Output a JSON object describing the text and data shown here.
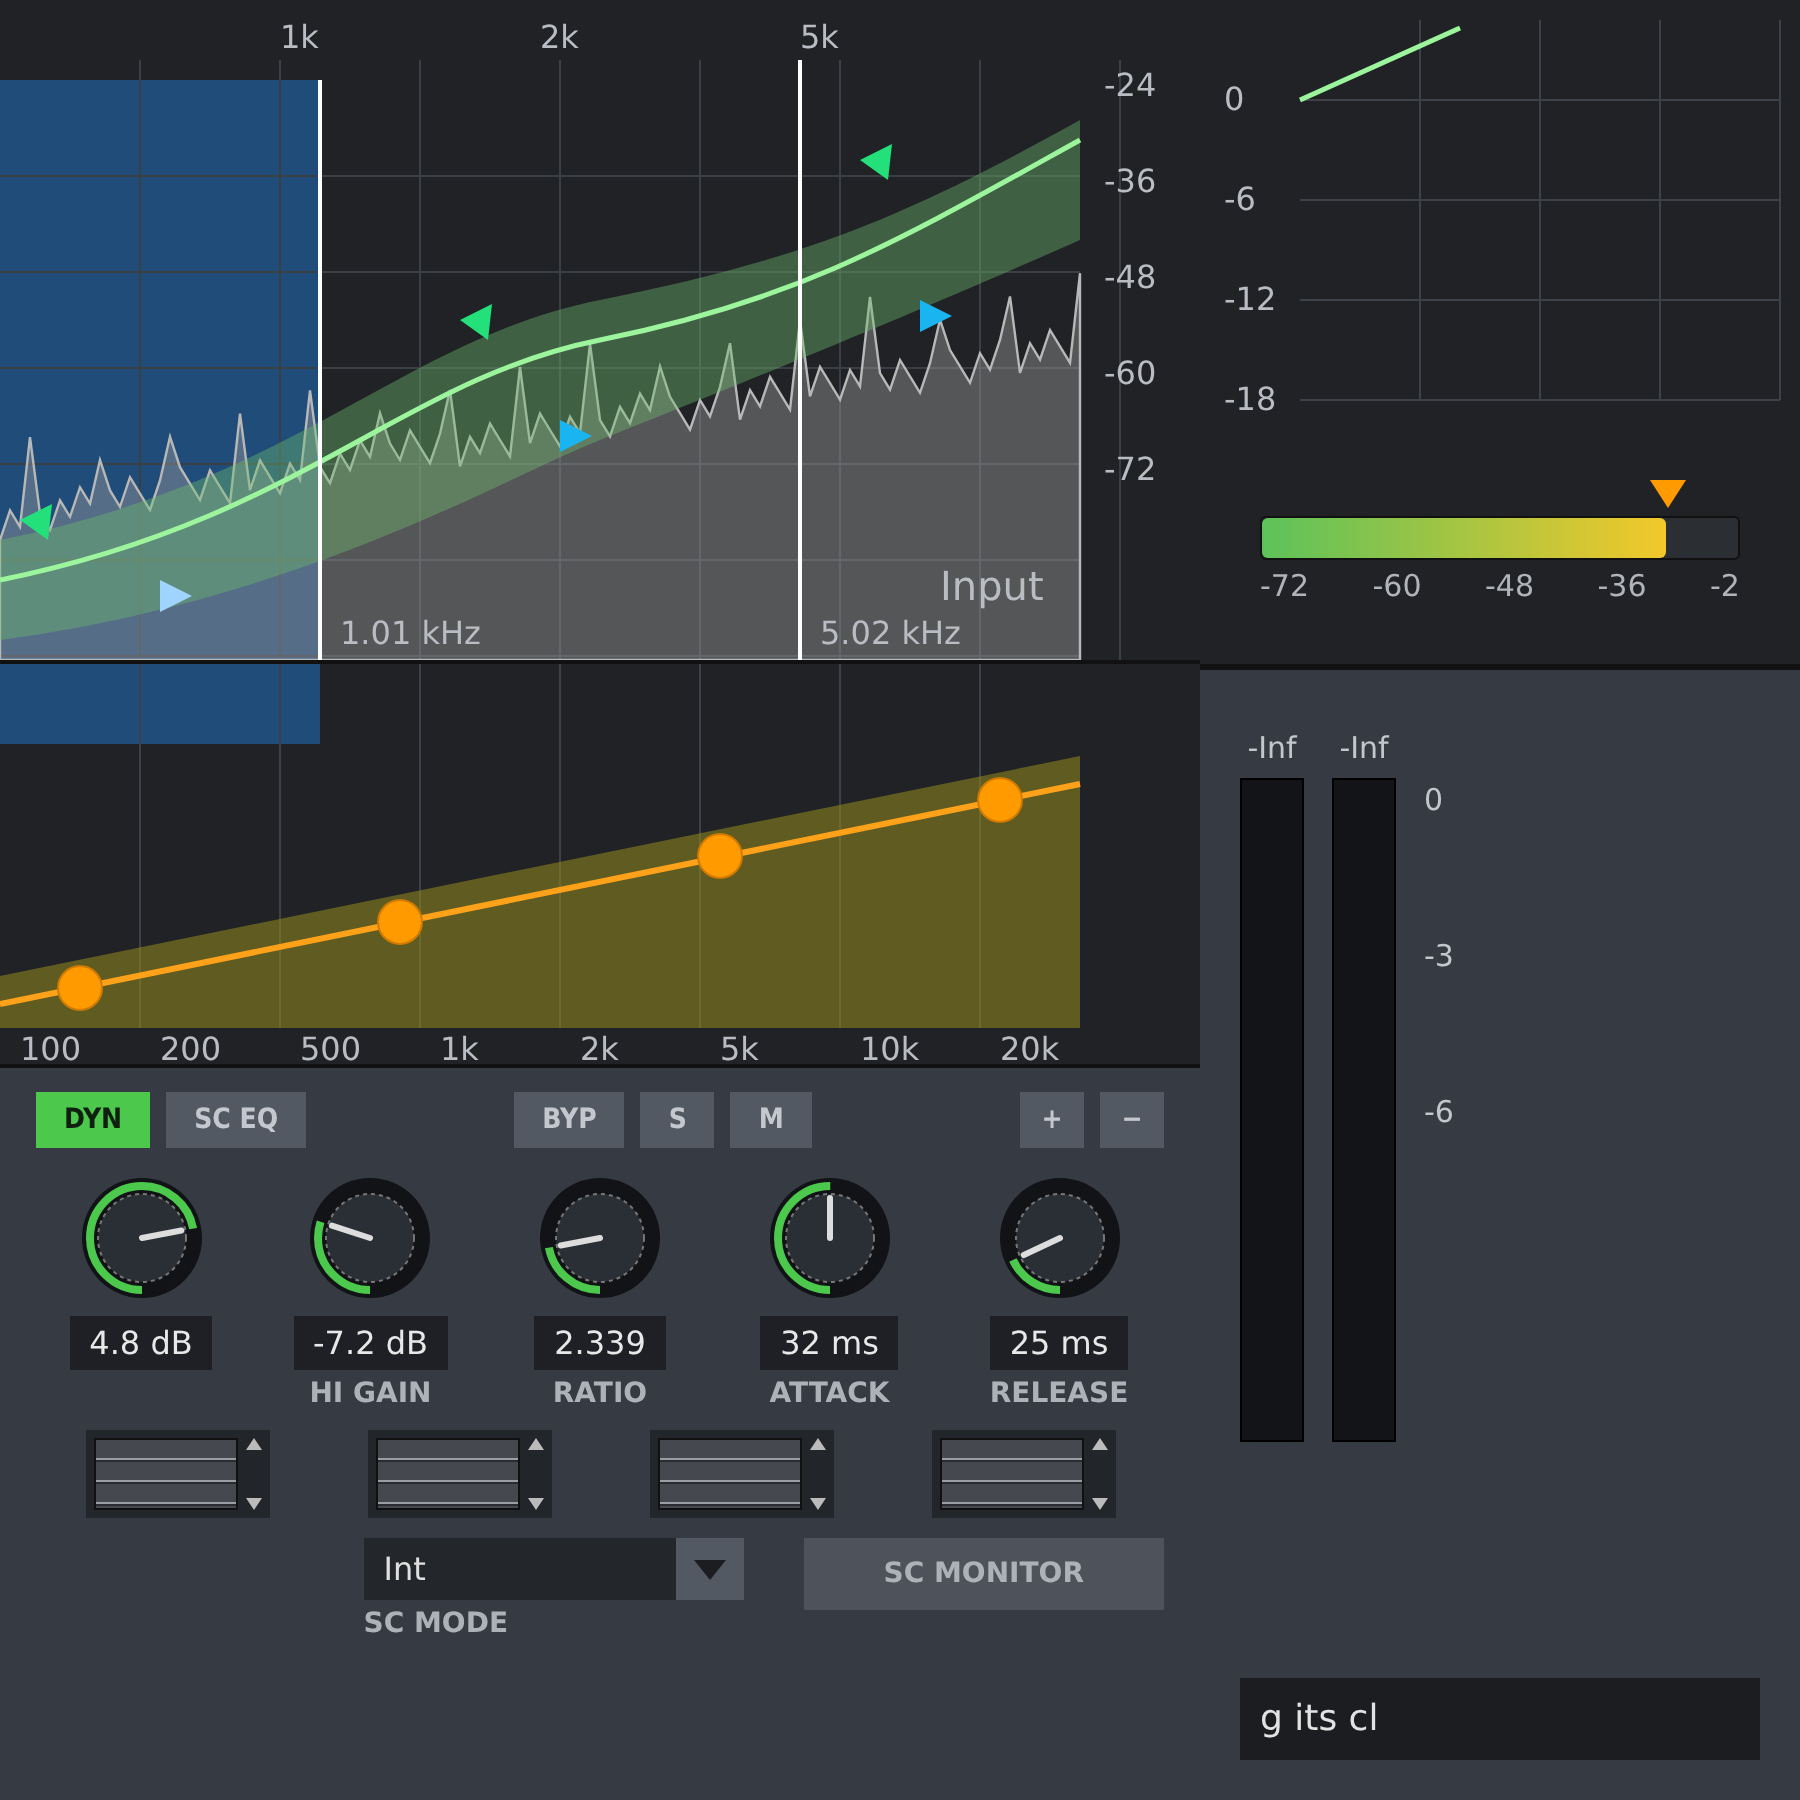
{
  "spectrum": {
    "freq_labels": [
      "1k",
      "2k",
      "5k"
    ],
    "db_labels": [
      "-24",
      "-36",
      "-48",
      "-60",
      "-72"
    ],
    "trace_label": "Input",
    "readouts": [
      "1.01 kHz",
      "5.02 kHz"
    ]
  },
  "band_chart": {
    "freq_labels": [
      "100",
      "200",
      "500",
      "1k",
      "2k",
      "5k",
      "10k",
      "20k"
    ]
  },
  "toolbar": {
    "mode_tabs": [
      {
        "label": "DYN",
        "selected": true
      },
      {
        "label": "SC EQ",
        "selected": false
      }
    ],
    "band_buttons": [
      "BYP",
      "S",
      "M"
    ],
    "zoom_buttons": [
      "+",
      "−"
    ]
  },
  "knobs": [
    {
      "value": "4.8 dB",
      "level": 0.72
    },
    {
      "value": "-7.2 dB",
      "label": "HI GAIN",
      "level": 0.3
    },
    {
      "value": "2.339",
      "label": "RATIO",
      "level": 0.22
    },
    {
      "value": "32 ms",
      "label": "ATTACK",
      "level": 0.5
    },
    {
      "value": "25 ms",
      "label": "RELEASE",
      "level": 0.18
    }
  ],
  "sc_mode": {
    "value": "Int",
    "label": "SC MODE"
  },
  "sc_monitor": {
    "label": "SC MONITOR",
    "on": false
  },
  "gain_grid": {
    "db_labels": [
      "0",
      "-6",
      "-12",
      "-18"
    ]
  },
  "level_meter": {
    "labels": [
      "-72",
      "-60",
      "-48",
      "-36",
      "-2"
    ],
    "level": 0.85
  },
  "output_meters": {
    "peaks": [
      "-Inf",
      "-Inf"
    ],
    "scale": [
      "0",
      "-3",
      "-6"
    ]
  },
  "footer_text": "g its cl"
}
